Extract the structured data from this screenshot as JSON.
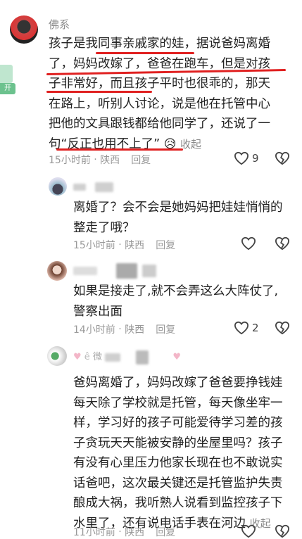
{
  "comments": [
    {
      "name": "佛系",
      "text_lines": [
        "孩子是我同事亲戚家的娃，据说爸妈离婚",
        "了，妈妈改嫁了，爸爸在跑车，但是对孩",
        "子非常好，而且孩子平时也很乖的，那天",
        "在路上，听别人讨论，说是他在托管中心",
        "把他的文具跟钱都给他同学了，还说了一",
        "句“反正也用不上了”"
      ],
      "collapse": "收起",
      "time": "15小时前",
      "location": "陕西",
      "reply": "回复",
      "likes": "9",
      "emoji": "😥"
    },
    {
      "name": "",
      "text_lines": [
        "离婚了？会不会是她妈妈把娃娃悄悄的",
        "整走了哦？"
      ],
      "time": "15小时前",
      "location": "陕西",
      "reply": "回复",
      "likes": ""
    },
    {
      "name": "",
      "text_lines": [
        "如果是接走了,就不会弄这么大阵仗了,",
        "警察出面"
      ],
      "time": "14小时前",
      "location": "陕西",
      "reply": "回复",
      "likes": "2"
    },
    {
      "name": "微",
      "text_lines": [
        "爸妈离婚了，妈妈改嫁了爸爸要挣钱娃",
        "每天除了学校就是托管，每天像坐牢一",
        "样，学习好的孩子可能爱待学习差的孩",
        "子贪玩天天能被安静的坐屋里吗？孩子",
        "有没有心里压力他家长现在也不敢说实",
        "话爸吧，这次最关键还是托管监护失责",
        "酿成大祸，我听熟人说看到监控孩子下",
        "水里了，还有说电话手表在河边"
      ],
      "collapse": "收起",
      "time": "11小时前",
      "location": "陕西",
      "reply": "回复",
      "likes": ""
    }
  ],
  "side_tab": "开",
  "colors": {
    "underline": "#e02020",
    "meta": "#999999",
    "text": "#222222"
  },
  "icons": [
    "heart-icon",
    "broken-heart-icon"
  ]
}
